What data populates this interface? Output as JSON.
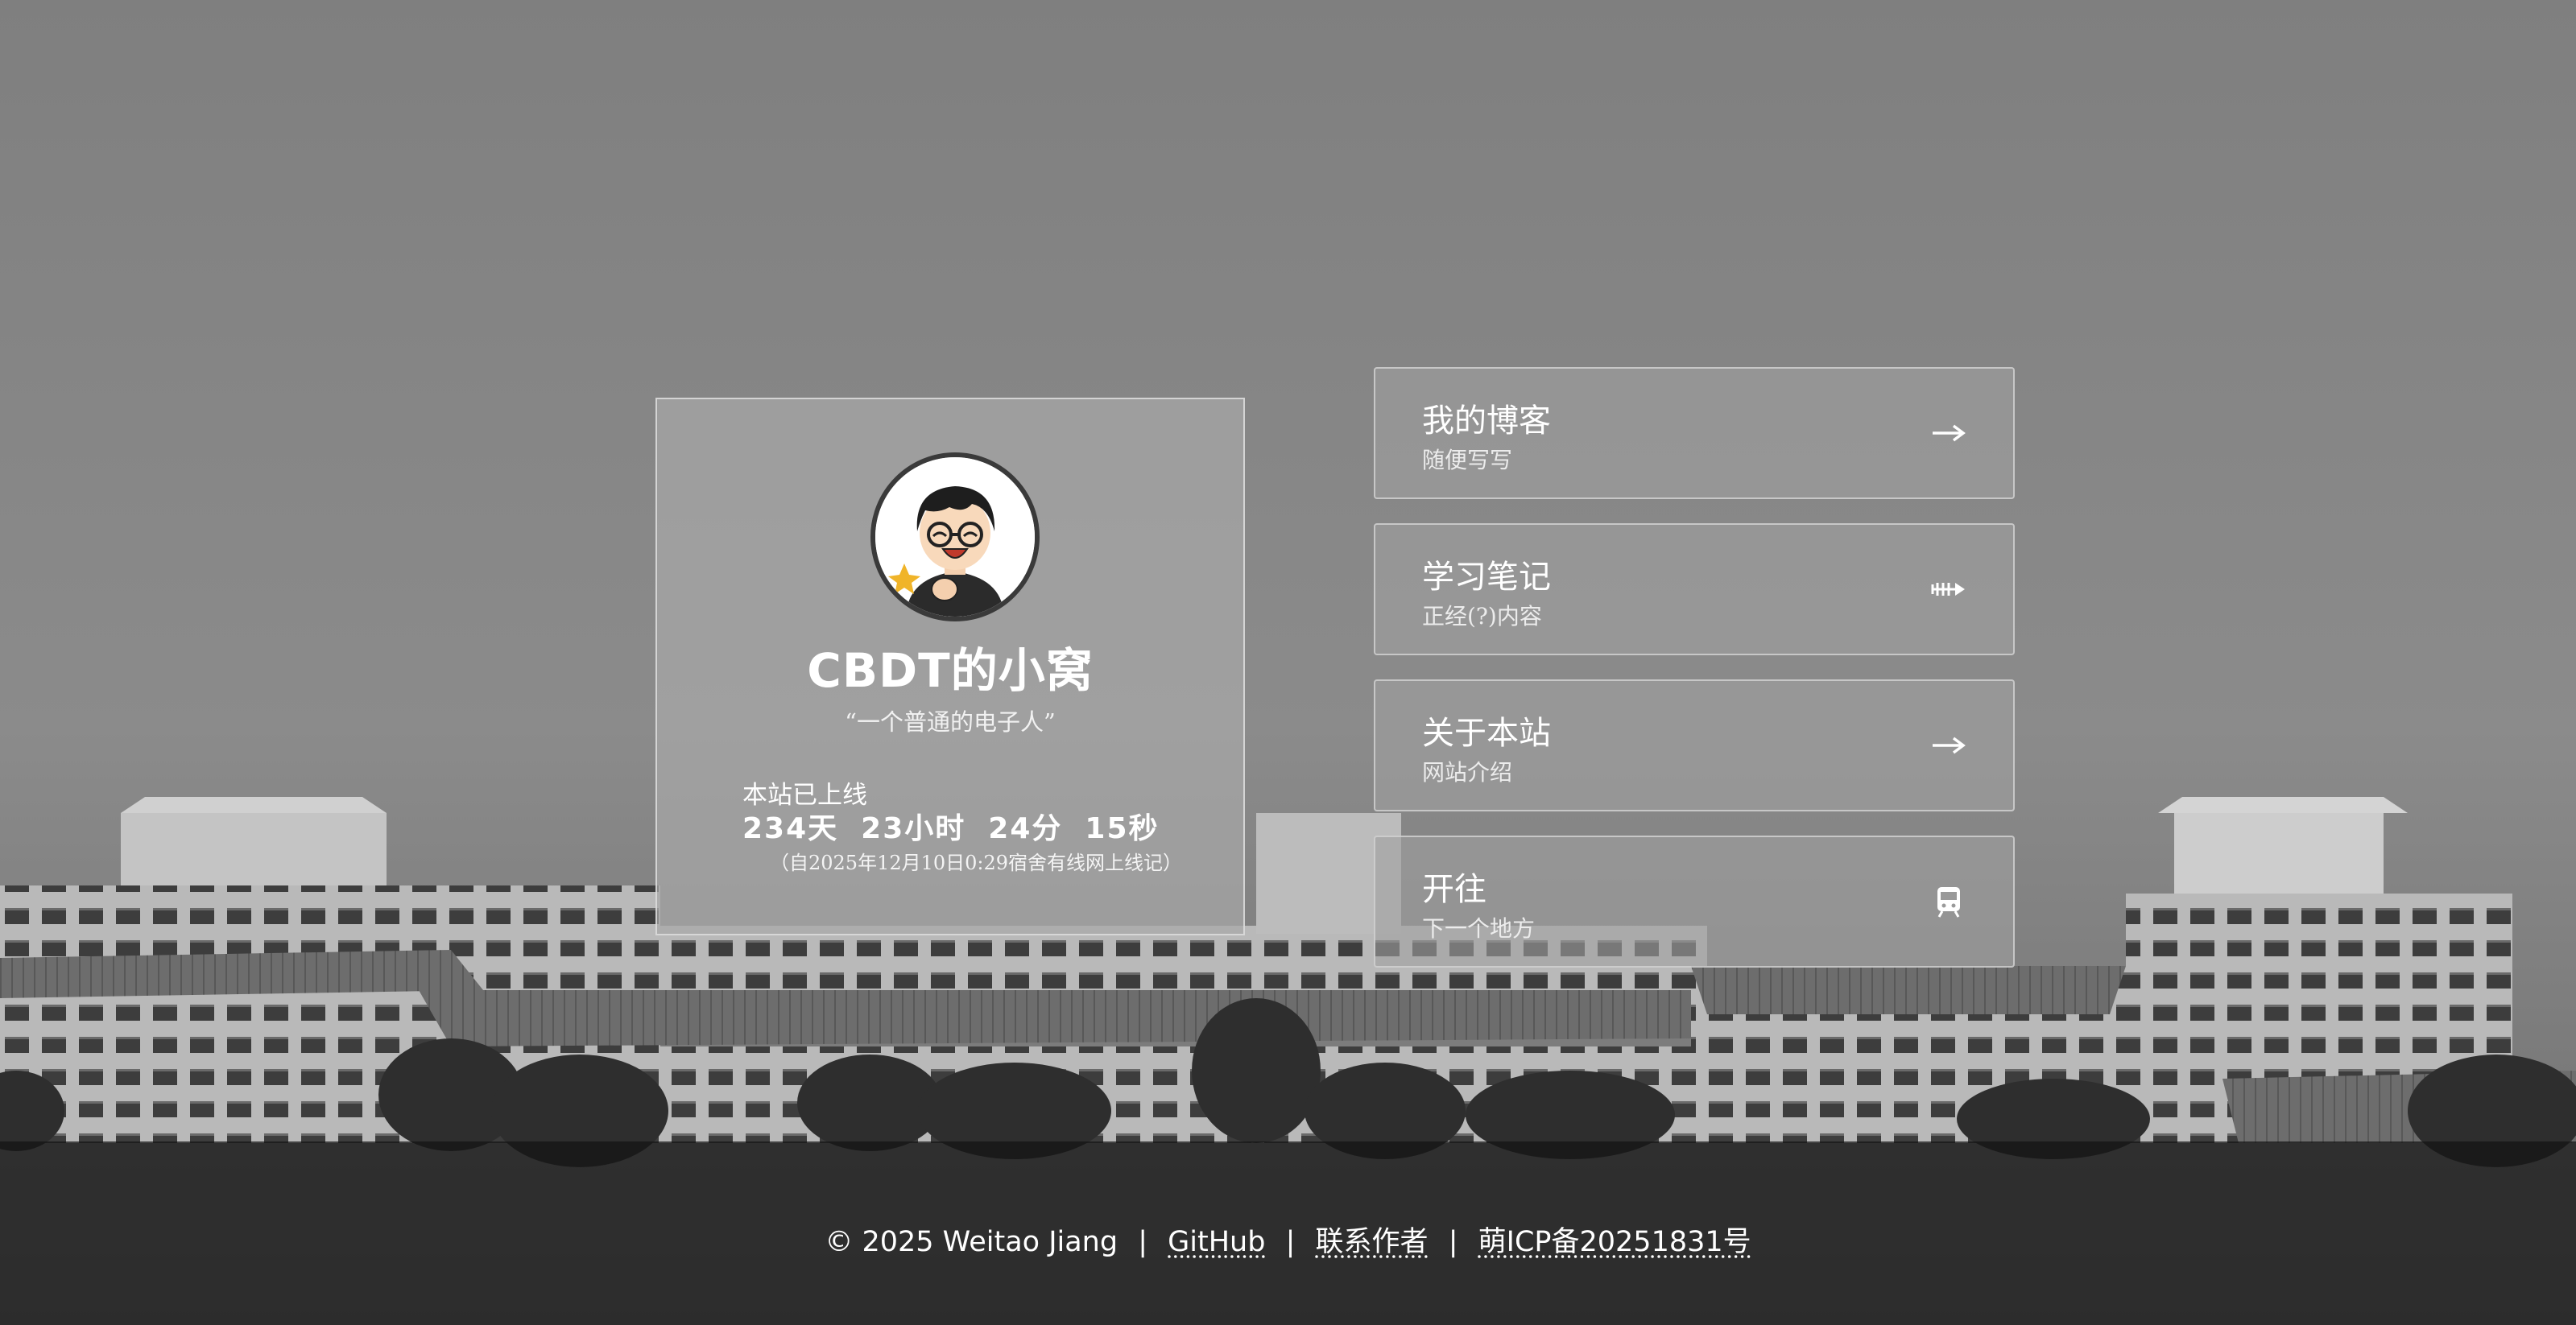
{
  "profile": {
    "avatar_icon": "cartoon-avatar-icon",
    "title": "CBDT的小窝",
    "motto": "“一个普通的电子人”",
    "uptime_label": "本站已上线",
    "uptime": {
      "days": "234",
      "days_unit": "天",
      "hours": "23",
      "hours_unit": "小时",
      "minutes": "24",
      "minutes_unit": "分",
      "seconds": "15",
      "seconds_unit": "秒"
    },
    "uptime_since": "（自2025年12月10日0:29宿舍有线网上线记）"
  },
  "nav": [
    {
      "title": "我的博客",
      "subtitle": "随便写写",
      "icon": "arrow-right-icon"
    },
    {
      "title": "学习笔记",
      "subtitle": "正经(?)内容",
      "icon": "fish-bone-icon"
    },
    {
      "title": "关于本站",
      "subtitle": "网站介绍",
      "icon": "arrow-right-icon"
    },
    {
      "title": "开往",
      "subtitle": "下一个地方",
      "icon": "train-icon"
    }
  ],
  "footer": {
    "copyright": "© 2025 Weitao Jiang",
    "separator": "|",
    "github": "GitHub",
    "contact": "联系作者",
    "icp": "萌ICP备20251831号"
  },
  "colors": {
    "card_bg": "#a8a8a8",
    "footer_bg": "#141414",
    "text": "#ffffff"
  }
}
